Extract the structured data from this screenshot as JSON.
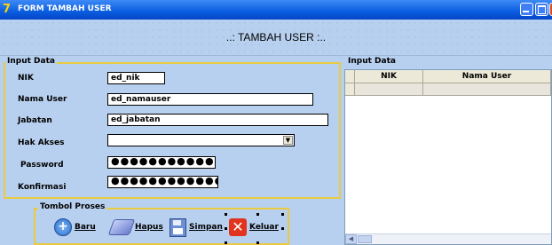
{
  "window": {
    "title": "FORM TAMBAH USER",
    "app_icon": "7"
  },
  "header": {
    "title": "..: TAMBAH USER :.."
  },
  "input_panel": {
    "legend": "Input Data",
    "fields": [
      {
        "label": "NIK",
        "value": "ed_nik"
      },
      {
        "label": "Nama User",
        "value": "ed_namauser"
      },
      {
        "label": "Jabatan",
        "value": "ed_jabatan"
      },
      {
        "label": "Hak Akses",
        "value": ""
      },
      {
        "label": "Password",
        "value": "●●●●●●●●●●●●"
      },
      {
        "label": "Konfirmasi",
        "value": "●●●●●●●●●●●●●"
      }
    ]
  },
  "buttons_panel": {
    "legend": "Tombol Proses",
    "buttons": [
      {
        "label": "Baru",
        "icon": "plus-circle-icon"
      },
      {
        "label": "Hapus",
        "icon": "eraser-icon"
      },
      {
        "label": "Simpan",
        "icon": "floppy-disk-icon"
      },
      {
        "label": "Keluar",
        "icon": "red-x-icon"
      }
    ]
  },
  "grid_panel": {
    "legend": "Input Data",
    "columns": [
      "NIK",
      "Nama User"
    ]
  },
  "colors": {
    "titlebar": "#0a5ddf",
    "form_bg": "#b8d0ef",
    "frame_border": "#e8cb3f",
    "close_button": "#d9481f"
  }
}
